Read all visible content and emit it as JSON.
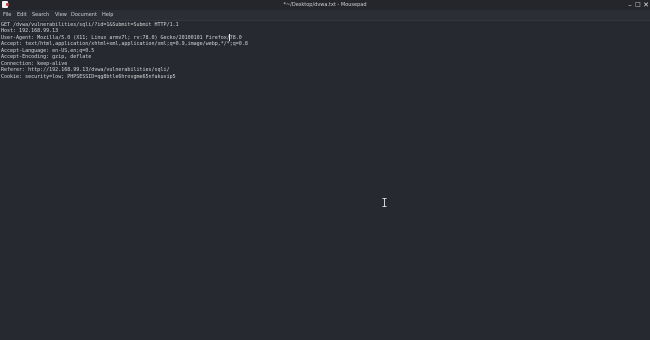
{
  "window": {
    "title": "*~/Desktop/dvwa.txt - Mousepad",
    "icon": "mousepad-app-icon",
    "controls": {
      "minimize_label": "–",
      "maximize_label": "□",
      "close_label": "✕"
    }
  },
  "menubar": {
    "items": [
      "File",
      "Edit",
      "Search",
      "View",
      "Document",
      "Help"
    ]
  },
  "editor": {
    "lines": [
      "GET /dvwa/vulnerabilities/sqli/?id=1&Submit=Submit HTTP/1.1",
      "Host: 192.168.99.13",
      "User-Agent: Mozilla/5.0 (X11; Linux armv7l; rv:78.0) Gecko/20100101 Firefox/78.0",
      "Accept: text/html,application/xhtml+xml,application/xml;q=0.9,image/webp,*/*;q=0.8",
      "Accept-Language: en-US,en;q=0.5",
      "Accept-Encoding: gzip, deflate",
      "Connection: keep-alive",
      "Referer: http://192.168.99.13/dvwa/vulnerabilities/sqli/",
      "Cookie: security=low; PHPSESSID=qg8btle6hrovgme65nfakuvip5"
    ]
  },
  "colors": {
    "background": "#262930",
    "menubar": "#2b2e35",
    "titlebar": "#24262c",
    "text": "#d6d6d6"
  }
}
